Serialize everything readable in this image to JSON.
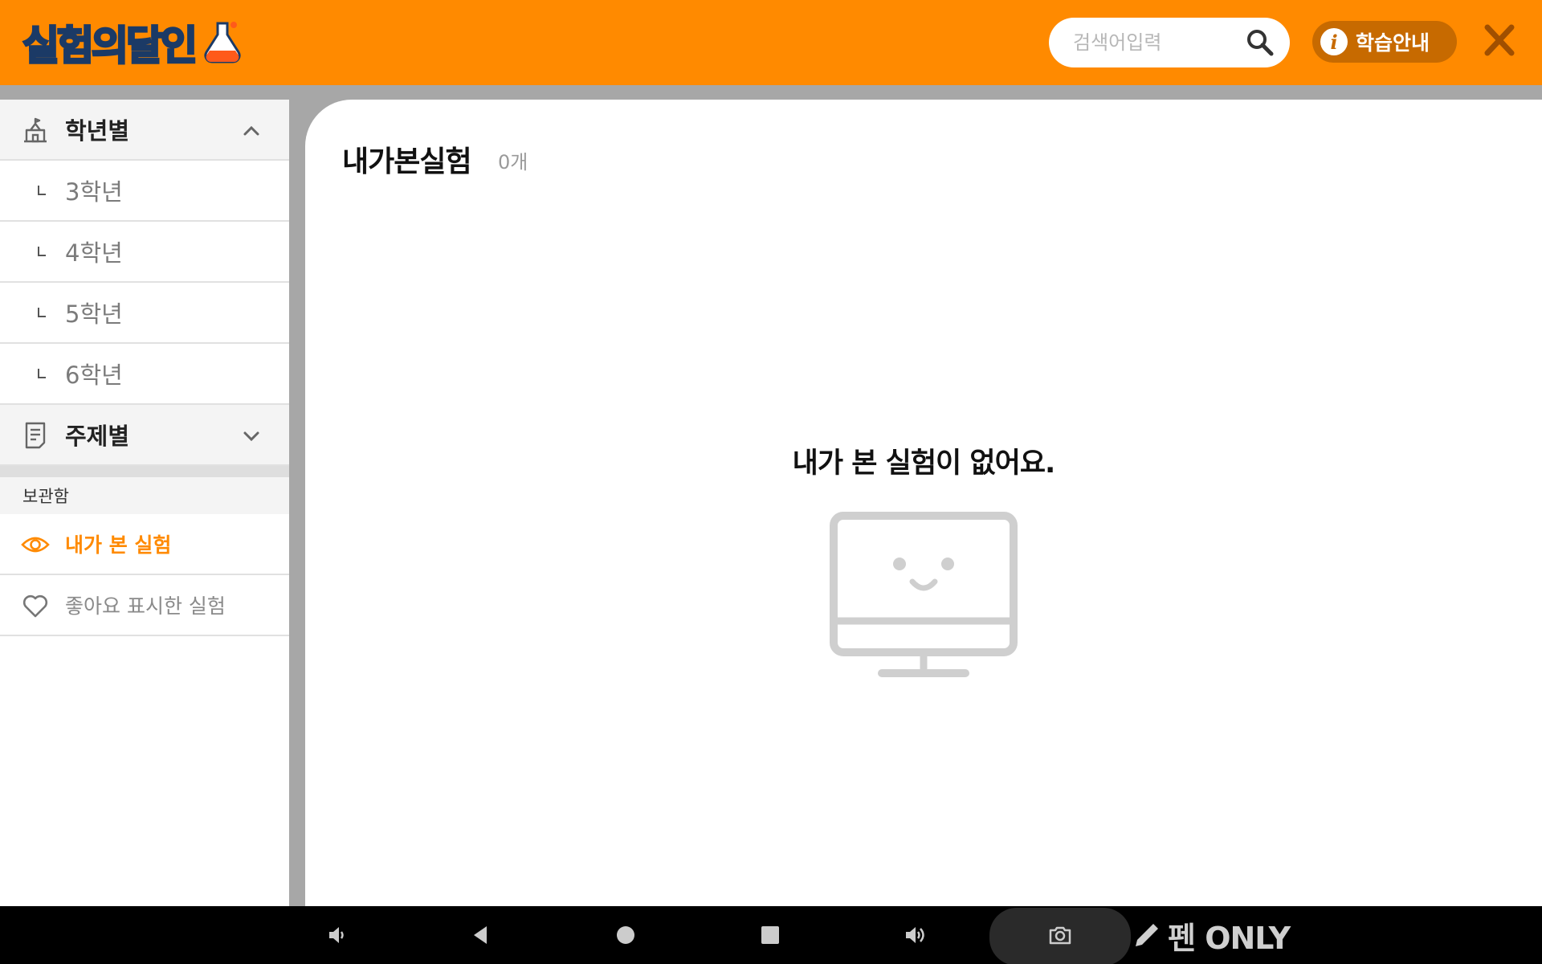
{
  "header": {
    "logo_text": "실험의달인",
    "search_placeholder": "검색어입력",
    "guide_label": "학습안내",
    "brand_color": "#ff8a00"
  },
  "sidebar": {
    "grade_group": {
      "label": "학년별",
      "expanded": true,
      "items": [
        {
          "label": "3학년"
        },
        {
          "label": "4학년"
        },
        {
          "label": "5학년"
        },
        {
          "label": "6학년"
        }
      ]
    },
    "topic_group": {
      "label": "주제별",
      "expanded": false
    },
    "storage": {
      "title": "보관함",
      "items": [
        {
          "label": "내가 본 실험",
          "icon": "eye-icon",
          "active": true
        },
        {
          "label": "좋아요 표시한 실험",
          "icon": "heart-icon",
          "active": false
        }
      ]
    }
  },
  "main": {
    "title": "내가본실험",
    "count": "0개",
    "empty_message": "내가 본 실험이 없어요.",
    "empty_icon": "monitor-smile-icon"
  },
  "navbar": {
    "pen_label": "펜 ONLY",
    "buttons": [
      "volume-down-icon",
      "back-icon",
      "home-icon",
      "recents-icon",
      "volume-up-icon",
      "camera-icon"
    ]
  }
}
